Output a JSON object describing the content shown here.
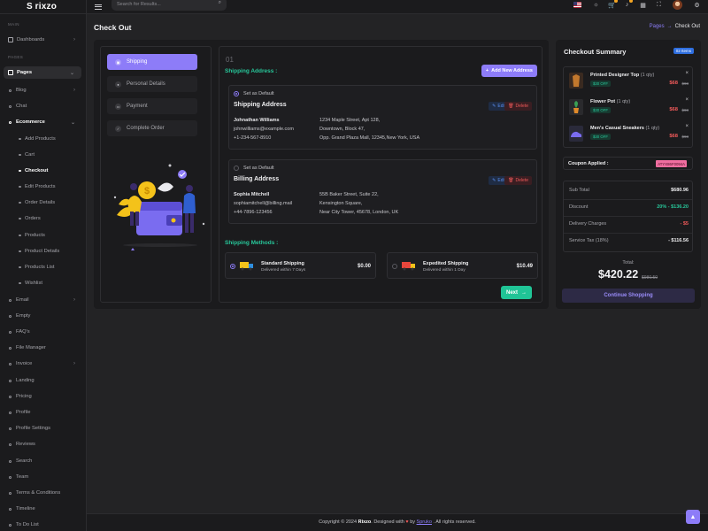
{
  "app": {
    "logo_mark": "S",
    "logo_name": "rixzo"
  },
  "sidebar": {
    "section_main": "MAIN",
    "section_pages": "PAGES",
    "dashboards": "Dashboards",
    "pages": "Pages",
    "items": [
      "Blog",
      "Chat",
      "Ecommerce",
      "Email",
      "Empty",
      "FAQ's",
      "File Manager",
      "Invoice",
      "Landing",
      "Pricing",
      "Profile",
      "Profile Settings",
      "Reviews",
      "Search",
      "Team",
      "Terms & Conditions",
      "Timeline",
      "To Do List"
    ],
    "ecommerce_sub": [
      "Add Products",
      "Cart",
      "Checkout",
      "Edit Products",
      "Order Details",
      "Orders",
      "Products",
      "Product Details",
      "Products List",
      "Wishlist"
    ]
  },
  "header": {
    "search_placeholder": "Search for Results..."
  },
  "page": {
    "title": "Check Out",
    "breadcrumb": {
      "link": "Pages",
      "sep": "→",
      "current": "Check Out"
    }
  },
  "steps": [
    "Shipping",
    "Personal Details",
    "Payment",
    "Complete Order"
  ],
  "form": {
    "step_number": "01",
    "shipping_title": "Shipping Address :",
    "add_address": "Add New Address",
    "edit": "Edit",
    "delete": "Delete",
    "addresses": [
      {
        "radio": "Set as Default",
        "title": "Shipping Address",
        "name": "Johnathan Williams",
        "email": "johnwilliams@example.com",
        "phone": "+1-234-567-8910",
        "lines": [
          "1234 Maple Street, Apt 128,",
          "Downtown, Block 47,",
          "Opp. Grand Plaza Mall, 12345,New York, USA"
        ]
      },
      {
        "radio": "Set as Default",
        "title": "Billing Address",
        "name": "Sophia Mitchell",
        "email": "sophiamitchell@billing.mail",
        "phone": "+44-7896-123456",
        "lines": [
          "55B Baker Street, Suite 22,",
          "Kensington Square,",
          "Near City Tower, 45678, London, UK"
        ]
      }
    ],
    "methods_title": "Shipping Methods :",
    "methods": [
      {
        "name": "Standard Shipping",
        "sub": "Delivered within 7 Days",
        "price": "$0.00"
      },
      {
        "name": "Expedited Shipping",
        "sub": "Delivered within 1 Day",
        "price": "$10.49"
      }
    ],
    "next": "Next"
  },
  "summary": {
    "title": "Checkout Summary",
    "badge": "02 Items",
    "items": [
      {
        "name": "Printed Designer Top",
        "qty": "(1 qty)",
        "off": "$30 OFF",
        "price": "$68",
        "old": "$98"
      },
      {
        "name": "Flower Pot",
        "qty": "(1 qty)",
        "off": "$30 OFF",
        "price": "$68",
        "old": "$98"
      },
      {
        "name": "Men's Casual Sneakers",
        "qty": "(1 qty)",
        "off": "$30 OFF",
        "price": "$68",
        "old": "$98"
      }
    ],
    "coupon_label": "Coupon Applied :",
    "coupon_code": "ATYX86F0094A",
    "rows": [
      {
        "label": "Sub Total",
        "value": "$680.96"
      },
      {
        "label": "Discount",
        "value": "20% - $136.20"
      },
      {
        "label": "Delivery Charges",
        "value": "- $5"
      },
      {
        "label": "Service Tax (18%)",
        "value": "- $116.56"
      }
    ],
    "total_label": "Total:",
    "total": "$420.22",
    "total_old": "$980.50",
    "continue": "Continue Shopping"
  },
  "footer": {
    "prefix": "Copyright © 2024",
    "brand": "Rixzo",
    "middle": ". Designed with",
    "by": "by",
    "author": "Spruko",
    "suffix": ". All rights reserved."
  },
  "colors": {
    "accent": "#8d7cf8",
    "success": "#20c496",
    "danger": "#f15a5a",
    "background": "#232325",
    "panel": "#1b1b1d"
  }
}
